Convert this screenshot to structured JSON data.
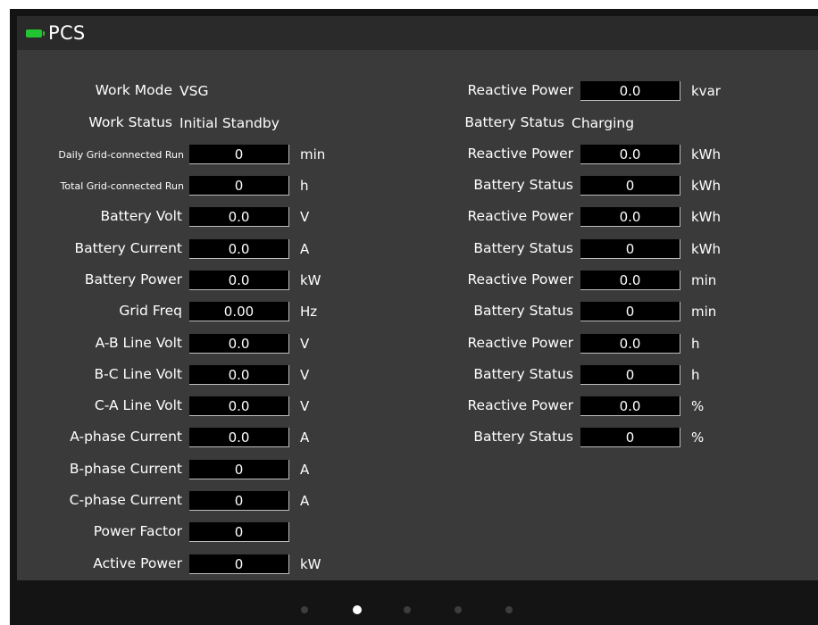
{
  "app": {
    "title": "PCS",
    "icon": "battery-icon",
    "accent": "#22c432"
  },
  "left": {
    "work_mode": {
      "label": "Work Mode",
      "value": "VSG"
    },
    "work_status": {
      "label": "Work Status",
      "value": "Initial Standby"
    },
    "fields": [
      {
        "label": "Daily Grid-connected Run",
        "value": "0",
        "unit": "min"
      },
      {
        "label": "Total Grid-connected Run",
        "value": "0",
        "unit": "h"
      },
      {
        "label": "Battery Volt",
        "value": "0.0",
        "unit": "V"
      },
      {
        "label": "Battery Current",
        "value": "0.0",
        "unit": "A"
      },
      {
        "label": "Battery Power",
        "value": "0.0",
        "unit": "kW"
      },
      {
        "label": "Grid Freq",
        "value": "0.00",
        "unit": "Hz"
      },
      {
        "label": "A-B Line Volt",
        "value": "0.0",
        "unit": "V"
      },
      {
        "label": "B-C Line Volt",
        "value": "0.0",
        "unit": "V"
      },
      {
        "label": "C-A Line Volt",
        "value": "0.0",
        "unit": "V"
      },
      {
        "label": "A-phase Current",
        "value": "0.0",
        "unit": "A"
      },
      {
        "label": "B-phase Current",
        "value": "0",
        "unit": "A"
      },
      {
        "label": "C-phase Current",
        "value": "0",
        "unit": "A"
      },
      {
        "label": "Power Factor",
        "value": "0",
        "unit": ""
      },
      {
        "label": "Active Power",
        "value": "0",
        "unit": "kW"
      }
    ]
  },
  "right": {
    "reactive_power": {
      "label": "Reactive Power",
      "value": "0.0",
      "unit": "kvar"
    },
    "battery_status": {
      "label": "Battery Status",
      "value": "Charging"
    },
    "fields": [
      {
        "label": "Reactive Power",
        "value": "0.0",
        "unit": "kWh"
      },
      {
        "label": "Battery Status",
        "value": "0",
        "unit": "kWh"
      },
      {
        "label": "Reactive Power",
        "value": "0.0",
        "unit": "kWh"
      },
      {
        "label": "Battery Status",
        "value": "0",
        "unit": "kWh"
      },
      {
        "label": "Reactive Power",
        "value": "0.0",
        "unit": "min"
      },
      {
        "label": "Battery Status",
        "value": "0",
        "unit": "min"
      },
      {
        "label": "Reactive Power",
        "value": "0.0",
        "unit": "h"
      },
      {
        "label": "Battery Status",
        "value": "0",
        "unit": "h"
      },
      {
        "label": "Reactive Power",
        "value": "0.0",
        "unit": "%"
      },
      {
        "label": "Battery Status",
        "value": "0",
        "unit": "%"
      }
    ]
  },
  "pagination": {
    "count": 5,
    "active_index": 1
  }
}
